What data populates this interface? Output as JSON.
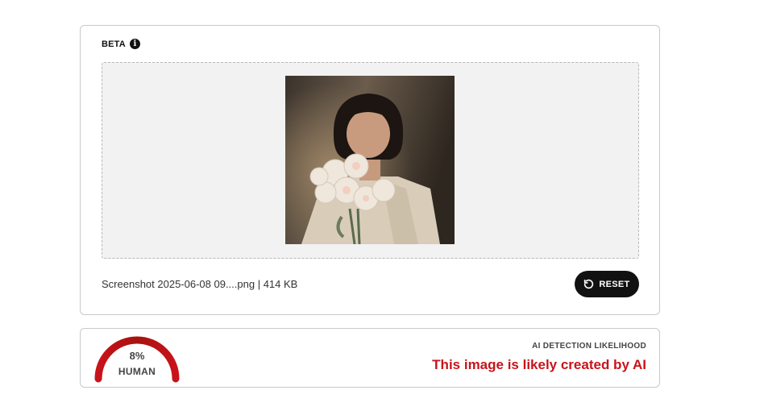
{
  "upload": {
    "badge": "BETA",
    "info_icon": "info-icon",
    "file_name": "Screenshot 2025-06-08 09....png",
    "separator": " | ",
    "file_size": "414 KB",
    "reset_label": "RESET",
    "reset_icon": "rotate-ccw-icon"
  },
  "result": {
    "gauge_percent": "8%",
    "gauge_label": "HUMAN",
    "human_fraction": 0.08,
    "title": "AI DETECTION LIKELIHOOD",
    "verdict": "This image is likely created by AI",
    "verdict_color": "#c8131a",
    "gauge_color": "#c8131a"
  }
}
